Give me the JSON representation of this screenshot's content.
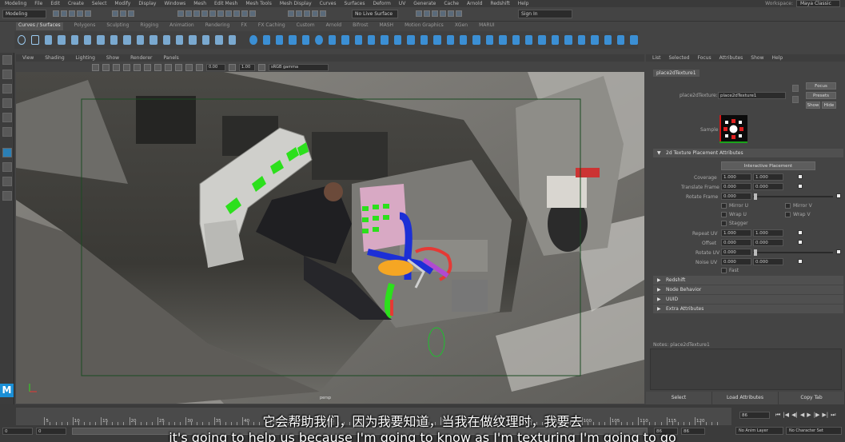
{
  "app": {
    "workspace_label": "Workspace:",
    "workspace_value": "Maya Classic"
  },
  "menubar": [
    "Modeling",
    "File",
    "Edit",
    "Create",
    "Select",
    "Modify",
    "Display",
    "Windows",
    "Mesh",
    "Edit Mesh",
    "Mesh Tools",
    "Mesh Display",
    "Curves",
    "Surfaces",
    "Deform",
    "UV",
    "Generate",
    "Cache",
    "Arnold",
    "Redshift",
    "Help"
  ],
  "statusline": {
    "mode": "Modeling",
    "live_surface": "No Live Surface",
    "sign_in": "Sign In"
  },
  "shelf_tabs": [
    "Curves / Surfaces",
    "Polygons",
    "Sculpting",
    "Rigging",
    "Animation",
    "Rendering",
    "FX",
    "FX Caching",
    "Custom",
    "Arnold",
    "Bifrost",
    "MASH",
    "Motion Graphics",
    "XGen",
    "MARUI"
  ],
  "viewport": {
    "menu": [
      "View",
      "Shading",
      "Lighting",
      "Show",
      "Renderer",
      "Panels"
    ],
    "num1": "0.00",
    "num2": "1.00",
    "color_space": "sRGB gamma",
    "camera_label": "persp"
  },
  "attr_editor": {
    "menu": [
      "List",
      "Selected",
      "Focus",
      "Attributes",
      "Show",
      "Help"
    ],
    "tab": "place2dTexture1",
    "node_label": "place2dTexture:",
    "node_value": "place2dTexture1",
    "btn_focus": "Focus",
    "btn_presets": "Presets",
    "btn_show": "Show",
    "btn_hide": "Hide",
    "sample_label": "Sample",
    "section_main": "2d Texture Placement Attributes",
    "interactive_placement": "Interactive Placement",
    "coverage_label": "Coverage",
    "coverage": [
      "1.000",
      "1.000"
    ],
    "translate_label": "Translate Frame",
    "translate": [
      "0.000",
      "0.000"
    ],
    "rotate_frame_label": "Rotate Frame",
    "rotate_frame": "0.000",
    "mirror_u": "Mirror U",
    "mirror_v": "Mirror V",
    "wrap_u": "Wrap U",
    "wrap_v": "Wrap V",
    "stagger": "Stagger",
    "repeat_label": "Repeat UV",
    "repeat": [
      "1.000",
      "1.000"
    ],
    "offset_label": "Offset",
    "offset": [
      "0.000",
      "0.000"
    ],
    "rotate_uv_label": "Rotate UV",
    "rotate_uv": "0.000",
    "noise_label": "Noise UV",
    "noise": [
      "0.000",
      "0.000"
    ],
    "fast": "Fast",
    "sections": [
      "Redshift",
      "Node Behavior",
      "UUID",
      "Extra Attributes"
    ],
    "notes": "Notes:  place2dTexture1",
    "bottom_buttons": [
      "Select",
      "Load Attributes",
      "Copy Tab"
    ]
  },
  "timeline": {
    "ticks": [
      "5",
      "10",
      "15",
      "20",
      "25",
      "30",
      "35",
      "40",
      "45",
      "50",
      "55",
      "60",
      "65",
      "70",
      "75",
      "80",
      "85",
      "90",
      "95",
      "100",
      "105",
      "110",
      "115",
      "120"
    ],
    "current_frame": "86",
    "start": "0",
    "end": "0",
    "range_end": "86",
    "range_end2": "86",
    "no_anim_layer": "No Anim Layer",
    "no_character": "No Character Set"
  },
  "subtitles": {
    "cn": "它会帮助我们，因为我要知道，当我在做纹理时，我要去",
    "en": "it's going to help us because I'm going to know as I'm texturing I'm going to go"
  },
  "colors": {
    "accent": "#2b7fb5",
    "green_mesh": "#2ce01c",
    "blue_mesh": "#1c2fd6",
    "pink": "#d8a9c4"
  }
}
